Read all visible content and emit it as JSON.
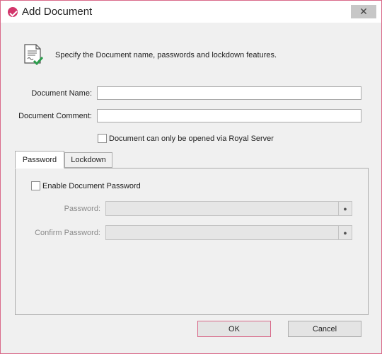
{
  "window": {
    "title": "Add Document",
    "close_glyph": "✕",
    "accent_color": "#d2366b"
  },
  "header": {
    "icon": "document-check-icon",
    "description": "Specify the Document name, passwords and lockdown features."
  },
  "form": {
    "document_name_label": "Document Name:",
    "document_name_value": "",
    "document_comment_label": "Document Comment:",
    "document_comment_value": "",
    "royal_server_checkbox_label": "Document can only be opened via Royal Server",
    "royal_server_checked": false
  },
  "tabs": [
    {
      "label": "Password",
      "active": true
    },
    {
      "label": "Lockdown",
      "active": false
    }
  ],
  "password_tab": {
    "enable_checkbox_label": "Enable Document Password",
    "enable_checked": false,
    "password_label": "Password:",
    "confirm_label": "Confirm Password:",
    "reveal_glyph": "●"
  },
  "buttons": {
    "ok_label": "OK",
    "cancel_label": "Cancel"
  }
}
